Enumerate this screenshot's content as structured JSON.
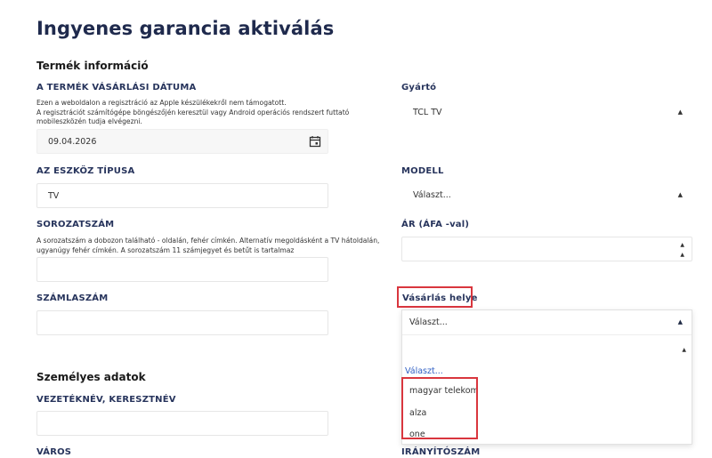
{
  "page": {
    "title": "Ingyenes garancia aktiválás"
  },
  "sections": {
    "product": "Termék információ",
    "personal": "Személyes adatok"
  },
  "purchase_date": {
    "label": "A TERMÉK VÁSÁRLÁSI DÁTUMA",
    "hint_line1": "Ezen a weboldalon a regisztráció az Apple készülékekről nem támogatott.",
    "hint_line2": "A regisztrációt számítógépe böngészőjén keresztül vagy Android operációs rendszert futtató",
    "hint_line3": "mobileszközén tudja elvégezni.",
    "value": "09.04.2026"
  },
  "manufacturer": {
    "label": "Gyártó",
    "value": "TCL TV"
  },
  "device_type": {
    "label": "AZ ESZKÖZ TÍPUSA",
    "value": "TV"
  },
  "model": {
    "label": "MODELL",
    "value": "Választ..."
  },
  "serial": {
    "label": "SOROZATSZÁM",
    "hint_line1": "A sorozatszám a dobozon található - oldalán, fehér címkén. Alternatív megoldásként a TV hátoldalán,",
    "hint_line2": "ugyanúgy fehér címkén. A sorozatszám 11 számjegyet és betűt is tartalmaz",
    "value": ""
  },
  "price": {
    "label": "ÁR (ÁFA -val)",
    "value": ""
  },
  "invoice": {
    "label": "SZÁMLASZÁM",
    "value": ""
  },
  "place_of_purchase": {
    "label": "Vásárlás helye",
    "value": "Választ...",
    "placeholder_option": "Választ...",
    "options": [
      "magyar telekom",
      "alza",
      "one"
    ]
  },
  "name": {
    "label": "VEZETÉKNÉV, KERESZTNÉV",
    "value": ""
  },
  "city": {
    "label": "VÁROS"
  },
  "zip": {
    "label": "IRÁNYÍTÓSZÁM"
  },
  "colors": {
    "title": "#1f2a4d",
    "label": "#27345c",
    "highlight": "#d9363e",
    "link": "#2f5fc4"
  }
}
